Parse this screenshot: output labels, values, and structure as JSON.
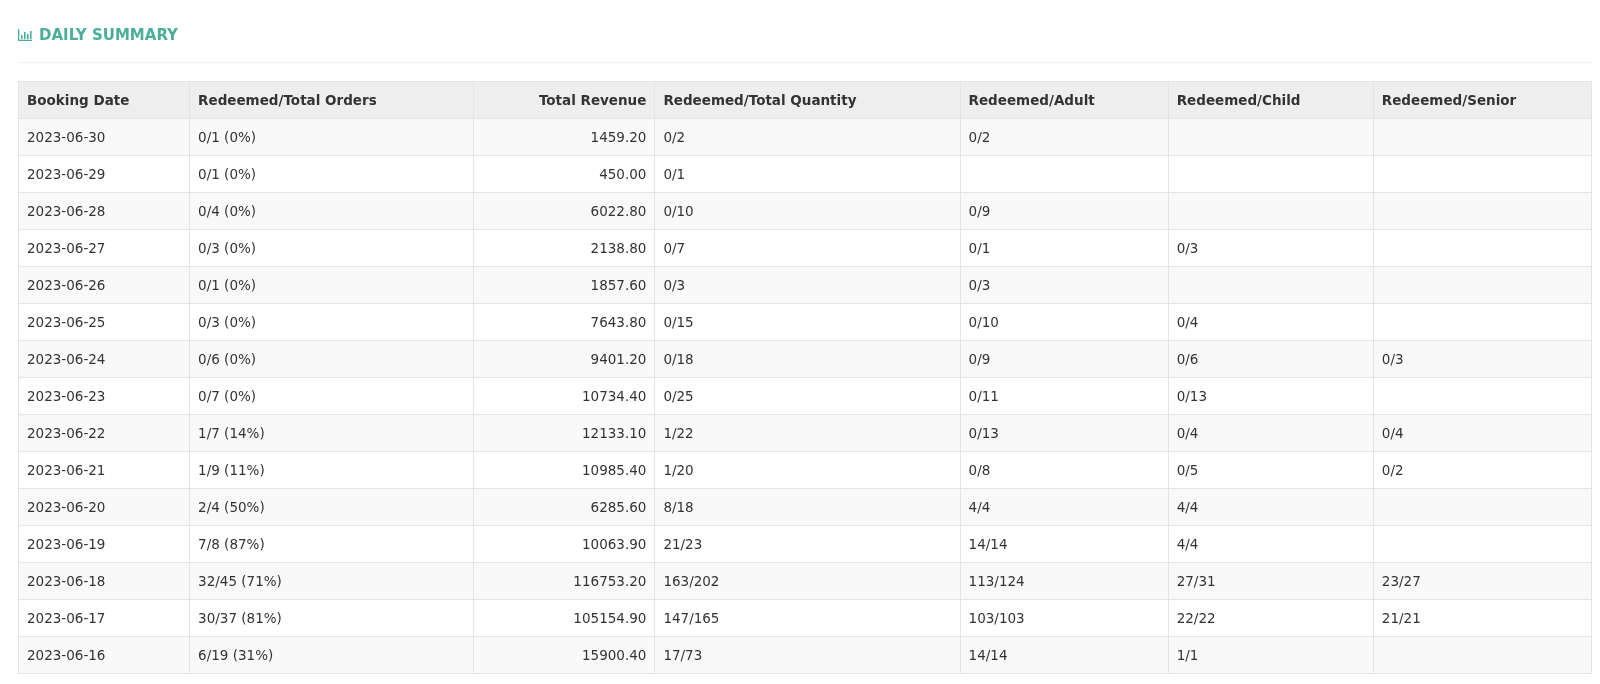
{
  "title": "DAILY SUMMARY",
  "table": {
    "columns": [
      "Booking Date",
      "Redeemed/Total Orders",
      "Total Revenue",
      "Redeemed/Total Quantity",
      "Redeemed/Adult",
      "Redeemed/Child",
      "Redeemed/Senior"
    ],
    "rows": [
      [
        "2023-06-30",
        "0/1 (0%)",
        "1459.20",
        "0/2",
        "0/2",
        null,
        null
      ],
      [
        "2023-06-29",
        "0/1 (0%)",
        "450.00",
        "0/1",
        null,
        null,
        null
      ],
      [
        "2023-06-28",
        "0/4 (0%)",
        "6022.80",
        "0/10",
        "0/9",
        null,
        null
      ],
      [
        "2023-06-27",
        "0/3 (0%)",
        "2138.80",
        "0/7",
        "0/1",
        "0/3",
        null
      ],
      [
        "2023-06-26",
        "0/1 (0%)",
        "1857.60",
        "0/3",
        "0/3",
        null,
        null
      ],
      [
        "2023-06-25",
        "0/3 (0%)",
        "7643.80",
        "0/15",
        "0/10",
        "0/4",
        null
      ],
      [
        "2023-06-24",
        "0/6 (0%)",
        "9401.20",
        "0/18",
        "0/9",
        "0/6",
        "0/3"
      ],
      [
        "2023-06-23",
        "0/7 (0%)",
        "10734.40",
        "0/25",
        "0/11",
        "0/13",
        null
      ],
      [
        "2023-06-22",
        "1/7 (14%)",
        "12133.10",
        "1/22",
        "0/13",
        "0/4",
        "0/4"
      ],
      [
        "2023-06-21",
        "1/9 (11%)",
        "10985.40",
        "1/20",
        "0/8",
        "0/5",
        "0/2"
      ],
      [
        "2023-06-20",
        "2/4 (50%)",
        "6285.60",
        "8/18",
        "4/4",
        "4/4",
        null
      ],
      [
        "2023-06-19",
        "7/8 (87%)",
        "10063.90",
        "21/23",
        "14/14",
        "4/4",
        null
      ],
      [
        "2023-06-18",
        "32/45 (71%)",
        "116753.20",
        "163/202",
        "113/124",
        "27/31",
        "23/27"
      ],
      [
        "2023-06-17",
        "30/37 (81%)",
        "105154.90",
        "147/165",
        "103/103",
        "22/22",
        "21/21"
      ],
      [
        "2023-06-16",
        "6/19 (31%)",
        "15900.40",
        "17/73",
        "14/14",
        "1/1",
        null
      ]
    ]
  }
}
